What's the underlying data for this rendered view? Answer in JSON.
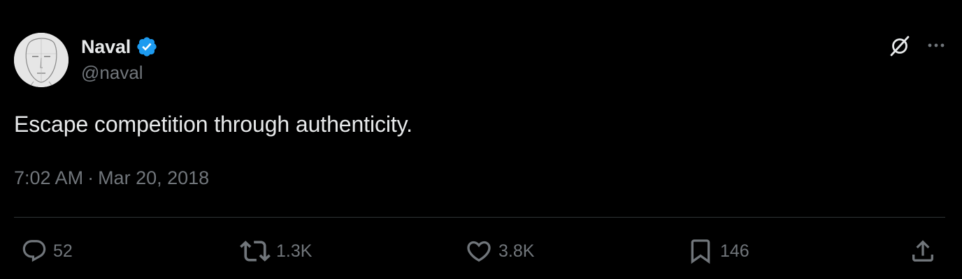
{
  "author": {
    "display_name": "Naval",
    "handle": "@naval",
    "verified": true
  },
  "tweet": {
    "text": "Escape competition through authenticity.",
    "time": "7:02 AM",
    "separator": "·",
    "date": "Mar 20, 2018"
  },
  "stats": {
    "replies": "52",
    "retweets": "1.3K",
    "likes": "3.8K",
    "bookmarks": "146"
  },
  "icons": {
    "verified": "verified-badge-icon",
    "grok": "grok-icon",
    "more": "more-icon",
    "reply": "reply-icon",
    "retweet": "retweet-icon",
    "like": "heart-icon",
    "bookmark": "bookmark-icon",
    "share": "share-icon"
  },
  "colors": {
    "background": "#000000",
    "primary_text": "#e7e9ea",
    "secondary_text": "#71767b",
    "verified_blue": "#1d9bf0",
    "divider": "#2f3336"
  }
}
